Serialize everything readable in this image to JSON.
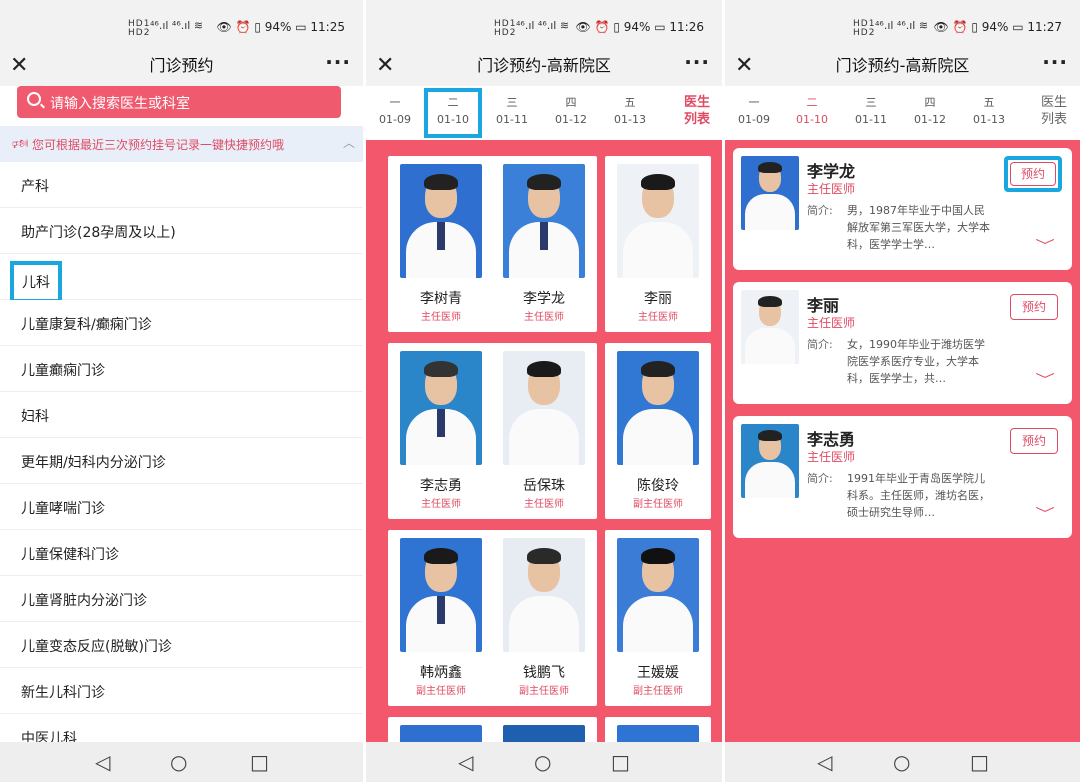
{
  "panel1": {
    "status": {
      "network": "HD1\nHD2",
      "signal": "⁴⁶.ıl ⁴⁶.ıl",
      "right": "👁 ⏰ ▯ 94% ▭ 11:25"
    },
    "title": "门诊预约",
    "search_placeholder": "请输入搜索医生或科室",
    "notice": "您可根据最近三次预约挂号记录一键快捷预约哦",
    "departments": [
      "产科",
      "助产门诊(28孕周及以上)",
      "儿科",
      "儿童康复科/癫痫门诊",
      "儿童癫痫门诊",
      "妇科",
      "更年期/妇科内分泌门诊",
      "儿童哮喘门诊",
      "儿童保健科门诊",
      "儿童肾脏内分泌门诊",
      "儿童变态反应(脱敏)门诊",
      "新生儿科门诊",
      "中医儿科"
    ]
  },
  "panel2": {
    "status": {
      "right": "👁 ⏰ ▯ 94% ▭ 11:26"
    },
    "title": "门诊预约-高新院区",
    "dates": [
      {
        "wd": "一",
        "d": "01-09"
      },
      {
        "wd": "二",
        "d": "01-10"
      },
      {
        "wd": "三",
        "d": "01-11"
      },
      {
        "wd": "四",
        "d": "01-12"
      },
      {
        "wd": "五",
        "d": "01-13"
      }
    ],
    "list_tab": "医生\n列表",
    "doctors": [
      {
        "name": "李树青",
        "title": "主任医师"
      },
      {
        "name": "李学龙",
        "title": "主任医师"
      },
      {
        "name": "李丽",
        "title": "主任医师"
      },
      {
        "name": "李志勇",
        "title": "主任医师"
      },
      {
        "name": "岳保珠",
        "title": "主任医师"
      },
      {
        "name": "陈俊玲",
        "title": "副主任医师"
      },
      {
        "name": "韩炳鑫",
        "title": "副主任医师"
      },
      {
        "name": "钱鹏飞",
        "title": "副主任医师"
      },
      {
        "name": "王媛媛",
        "title": "副主任医师"
      }
    ]
  },
  "panel3": {
    "status": {
      "right": "👁 ⏰ ▯ 94% ▭ 11:27"
    },
    "title": "门诊预约-高新院区",
    "dates": [
      {
        "wd": "一",
        "d": "01-09"
      },
      {
        "wd": "二",
        "d": "01-10"
      },
      {
        "wd": "三",
        "d": "01-11"
      },
      {
        "wd": "四",
        "d": "01-12"
      },
      {
        "wd": "五",
        "d": "01-13"
      }
    ],
    "list_tab": "医生\n列表",
    "intro_label": "简介:",
    "book_label": "预约",
    "doctors": [
      {
        "name": "李学龙",
        "title": "主任医师",
        "intro": "男，1987年毕业于中国人民解放军第三军医大学，大学本科，医学学士学…"
      },
      {
        "name": "李丽",
        "title": "主任医师",
        "intro": "女，1990年毕业于潍坊医学院医学系医疗专业，大学本科，医学学士，共…"
      },
      {
        "name": "李志勇",
        "title": "主任医师",
        "intro": "1991年毕业于青岛医学院儿科系。主任医师，潍坊名医，硕士研究生导师…"
      }
    ]
  },
  "colors": {
    "brand": "#f2576c",
    "highlight": "#1aa7df"
  }
}
